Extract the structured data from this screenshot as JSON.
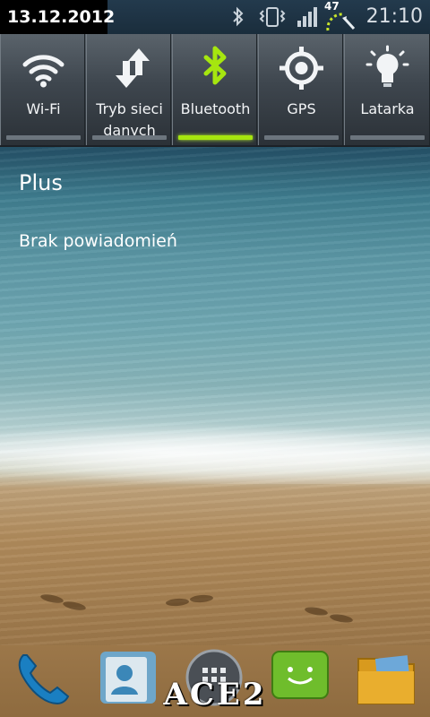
{
  "status_bar": {
    "date": "13.12.2012",
    "time": "21:10",
    "speed_indicator": "47",
    "icons": [
      "bluetooth-icon",
      "vibrate-icon",
      "signal-icon",
      "data-speed-icon"
    ]
  },
  "quick_panel": {
    "tiles": [
      {
        "label": "Wi-Fi",
        "icon": "wifi-icon",
        "active": false
      },
      {
        "label": "Tryb sieci danych",
        "icon": "data-transfer-icon",
        "active": false
      },
      {
        "label": "Bluetooth",
        "icon": "bluetooth-icon",
        "active": true
      },
      {
        "label": "GPS",
        "icon": "gps-icon",
        "active": false
      },
      {
        "label": "Latarka",
        "icon": "flashlight-icon",
        "active": false
      }
    ],
    "active_color": "#a6e60f"
  },
  "notifications": {
    "operator": "Plus",
    "empty_text": "Brak powiadomień"
  },
  "dock": {
    "apps": [
      "phone-icon",
      "contacts-icon",
      "apps-grid-icon",
      "messages-icon",
      "files-icon"
    ]
  },
  "watermark": "ACE2"
}
